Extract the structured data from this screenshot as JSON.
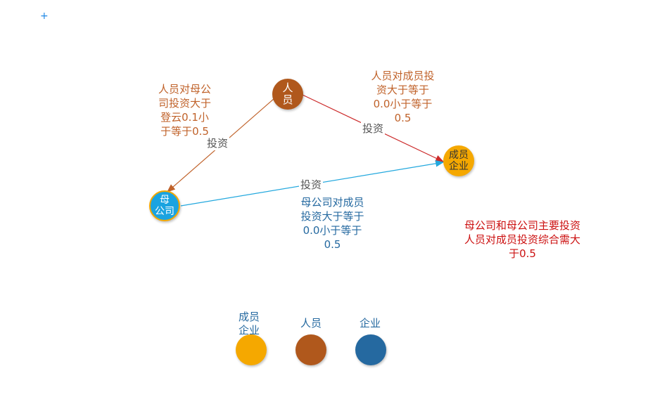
{
  "colors": {
    "person": "#b0581c",
    "parent": "#1aa3e0",
    "member": "#f5a800",
    "enterprise": "#2569a0",
    "edge_person_parent": "#c0622a",
    "edge_person_member": "#cc2a2a",
    "edge_parent_member": "#23a8de",
    "text_orange": "#c0622a",
    "text_blue": "#2569a0",
    "text_red": "#cc1111"
  },
  "nodes": {
    "person": "人\n员",
    "parent": "母\n公司",
    "member": "成员\n企业"
  },
  "edges": {
    "person_to_parent": {
      "label": "投资",
      "condition": "人员对母公\n司投资大于\n登云0.1小\n于等于0.5"
    },
    "person_to_member": {
      "label": "投资",
      "condition": "人员对成员投\n资大于等于\n0.0小于等于\n0.5"
    },
    "parent_to_member": {
      "label": "投资",
      "condition": "母公司对成员\n投资大于等于\n0.0小于等于\n0.5"
    }
  },
  "note": "母公司和母公司主要投资\n人员对成员投资综合需大\n于0.5",
  "legend": [
    {
      "label": "成员\n企业",
      "color": "#f5a800"
    },
    {
      "label": "人员",
      "color": "#b0581c"
    },
    {
      "label": "企业",
      "color": "#2569a0"
    }
  ]
}
